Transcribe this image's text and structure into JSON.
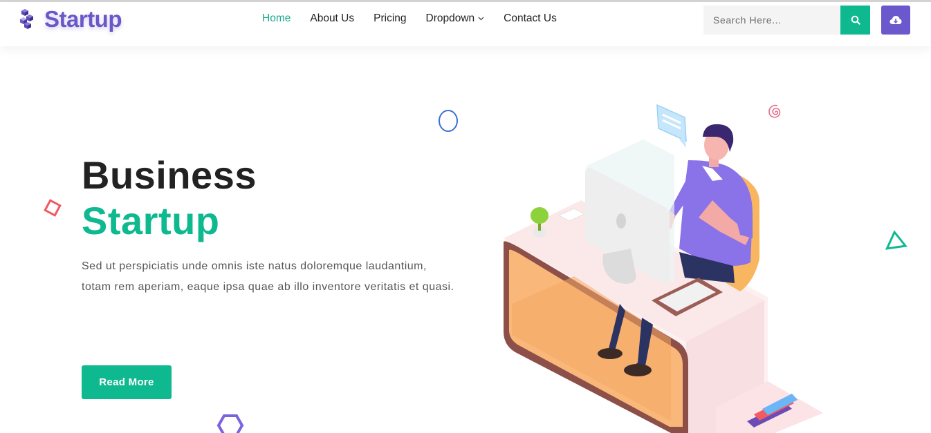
{
  "brand": {
    "name": "Startup"
  },
  "nav": {
    "items": [
      {
        "label": "Home",
        "active": true
      },
      {
        "label": "About Us",
        "active": false
      },
      {
        "label": "Pricing",
        "active": false
      },
      {
        "label": "Dropdown",
        "active": false,
        "has_dropdown": true
      },
      {
        "label": "Contact Us",
        "active": false
      }
    ]
  },
  "search": {
    "placeholder": "Search Here...",
    "value": ""
  },
  "icons": {
    "logo": "cube-stack-icon",
    "search": "search-icon",
    "cloud": "cloud-download-icon",
    "dropdown": "chevron-down-icon"
  },
  "hero": {
    "title_line1": "Business",
    "title_line2": "Startup",
    "description": "Sed ut perspiciatis unde omnis iste natus doloremque laudantium, totam rem aperiam, eaque ipsa quae ab illo inventore veritatis et quasi.",
    "button_label": "Read More"
  },
  "colors": {
    "brand_purple": "#6a58c9",
    "accent_green": "#0fb98f",
    "heading": "#222222",
    "body_text": "#555555"
  }
}
